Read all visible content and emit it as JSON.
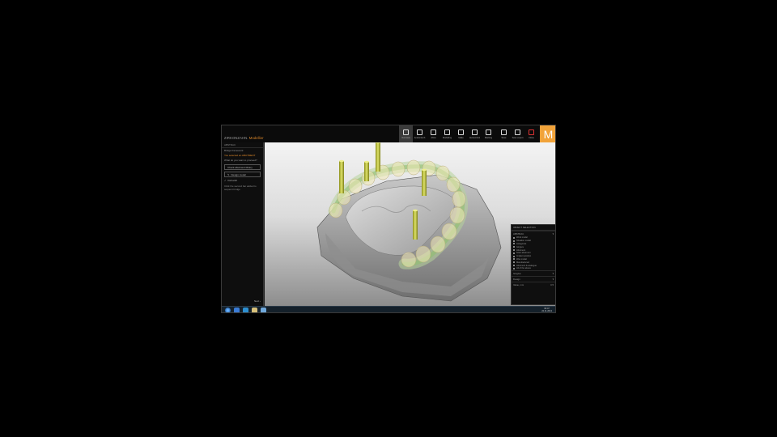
{
  "app": {
    "title_brand": "ZIRKONZAHN.",
    "title_product": "Modellier"
  },
  "toolbar": {
    "tools": [
      {
        "label": "Overview"
      },
      {
        "label": "Anatomisch"
      },
      {
        "label": "Abtra"
      },
      {
        "label": "Modelling"
      },
      {
        "label": "Make"
      },
      {
        "label": "Autocontrol"
      },
      {
        "label": "Marking"
      }
    ],
    "file_tools": [
      {
        "label": "Save"
      },
      {
        "label": "Save export"
      },
      {
        "label": "Close"
      }
    ],
    "logo": "M"
  },
  "left_panel": {
    "header": "ABSTRAC",
    "line1": "Bridge framework",
    "line2": "You selected an ABUTMENT",
    "line3": "What do you want to proceed?",
    "btn1": "Check abutment library",
    "btn2": "Design model",
    "check1": "Full arch",
    "note": "Click the second bar added to sequent bridge",
    "next": "Next"
  },
  "right_panel": {
    "header": "OBJECT SELECTION",
    "section1": "ABSTRAC",
    "items": [
      "Work model",
      "Situation model",
      "Antagonist",
      "Gingiva",
      "Abutment",
      "Scan abutment",
      "Implant position",
      "Wax model",
      "Manufactured",
      "Abutment & analogue",
      "All of the above"
    ],
    "section2": "Gingiva",
    "section3": "Design",
    "value_label": "Value, mm",
    "value": "0.5"
  },
  "taskbar": {
    "time": "09:47",
    "date": "22.11.2013"
  }
}
